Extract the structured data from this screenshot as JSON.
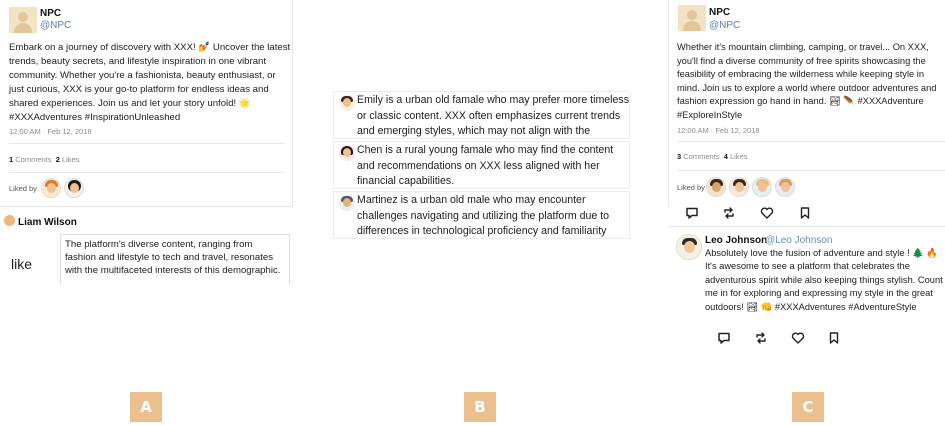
{
  "panel_a": {
    "user_name": "NPC",
    "user_handle": "@NPC",
    "post_text": "Embark on a journey of discovery with XXX! 💅 Uncover the latest trends, beauty secrets, and lifestyle inspiration in one vibrant community. Whether you're a fashionista, beauty enthusiast, or just curious, XXX is your go-to platform for endless ideas and shared experiences. Join us and let your story unfold! 🌟 #XXXAdventures #InspirationUnleashed",
    "timestamp": "12:00 AM · Feb 12, 2018",
    "comments_count": "1",
    "comments_label": "Comments",
    "likes_count": "2",
    "likes_label": "Likes",
    "liked_by_label": "Liked by",
    "comment_user": "Liam Wilson",
    "like_label": "like",
    "like_text": "The platform's diverse content, ranging from fashion and lifestyle to tech and travel, resonates with the multifaceted interests of this demographic. …"
  },
  "panel_b": {
    "personas": [
      {
        "text": "Emily is a urban old famale who may prefer more timeless or classic content. XXX often emphasizes current trends and emerging styles, which may not align with the",
        "hair": "#3a2a1c"
      },
      {
        "text": "Chen is a rural young famale who may find the content and recommendations on XXX less aligned with her financial capabilities.",
        "hair": "#1a1a1a"
      },
      {
        "text": "Martinez is a urban old male who may encounter challenges navigating and utilizing the platform due to differences in technological proficiency and familiarity",
        "hair": "#5a5a5a"
      }
    ]
  },
  "panel_c": {
    "user_name": "NPC",
    "user_handle": "@NPC",
    "post_text": "Whether it's mountain climbing, camping, or travel... On XXX, you'll find a diverse community of free spirits showcasing the feasibility of embracing the wilderness while keeping style in mind. Join us to explore a world where outdoor adventures and fashion expression go hand in hand. 🏞 🪶 #XXXAdventure #ExploreInStyle",
    "timestamp": "12:00 AM · Feb 12, 2018",
    "comments_count": "3",
    "comments_label": "Comments",
    "likes_count": "4",
    "likes_label": "Likes",
    "liked_by_label": "Liked by",
    "reply_name": "Leo Johnson",
    "reply_handle": "@Leo Johnson",
    "reply_text": "Absolutely love the fusion of adventure and style ! 🌲 🔥 It's awesome to see a platform that celebrates the adventurous spirit while also keeping things stylish. Count me in for exploring and expressing my style in the great outdoors! 🏞 👊 #XXXAdventures #AdventureStyle"
  },
  "labels": {
    "a": "A",
    "b": "B",
    "c": "C"
  },
  "colors": {
    "label_bg": "#ecc08e",
    "handle": "#5a7fb0",
    "muted": "#8b8b8b"
  }
}
